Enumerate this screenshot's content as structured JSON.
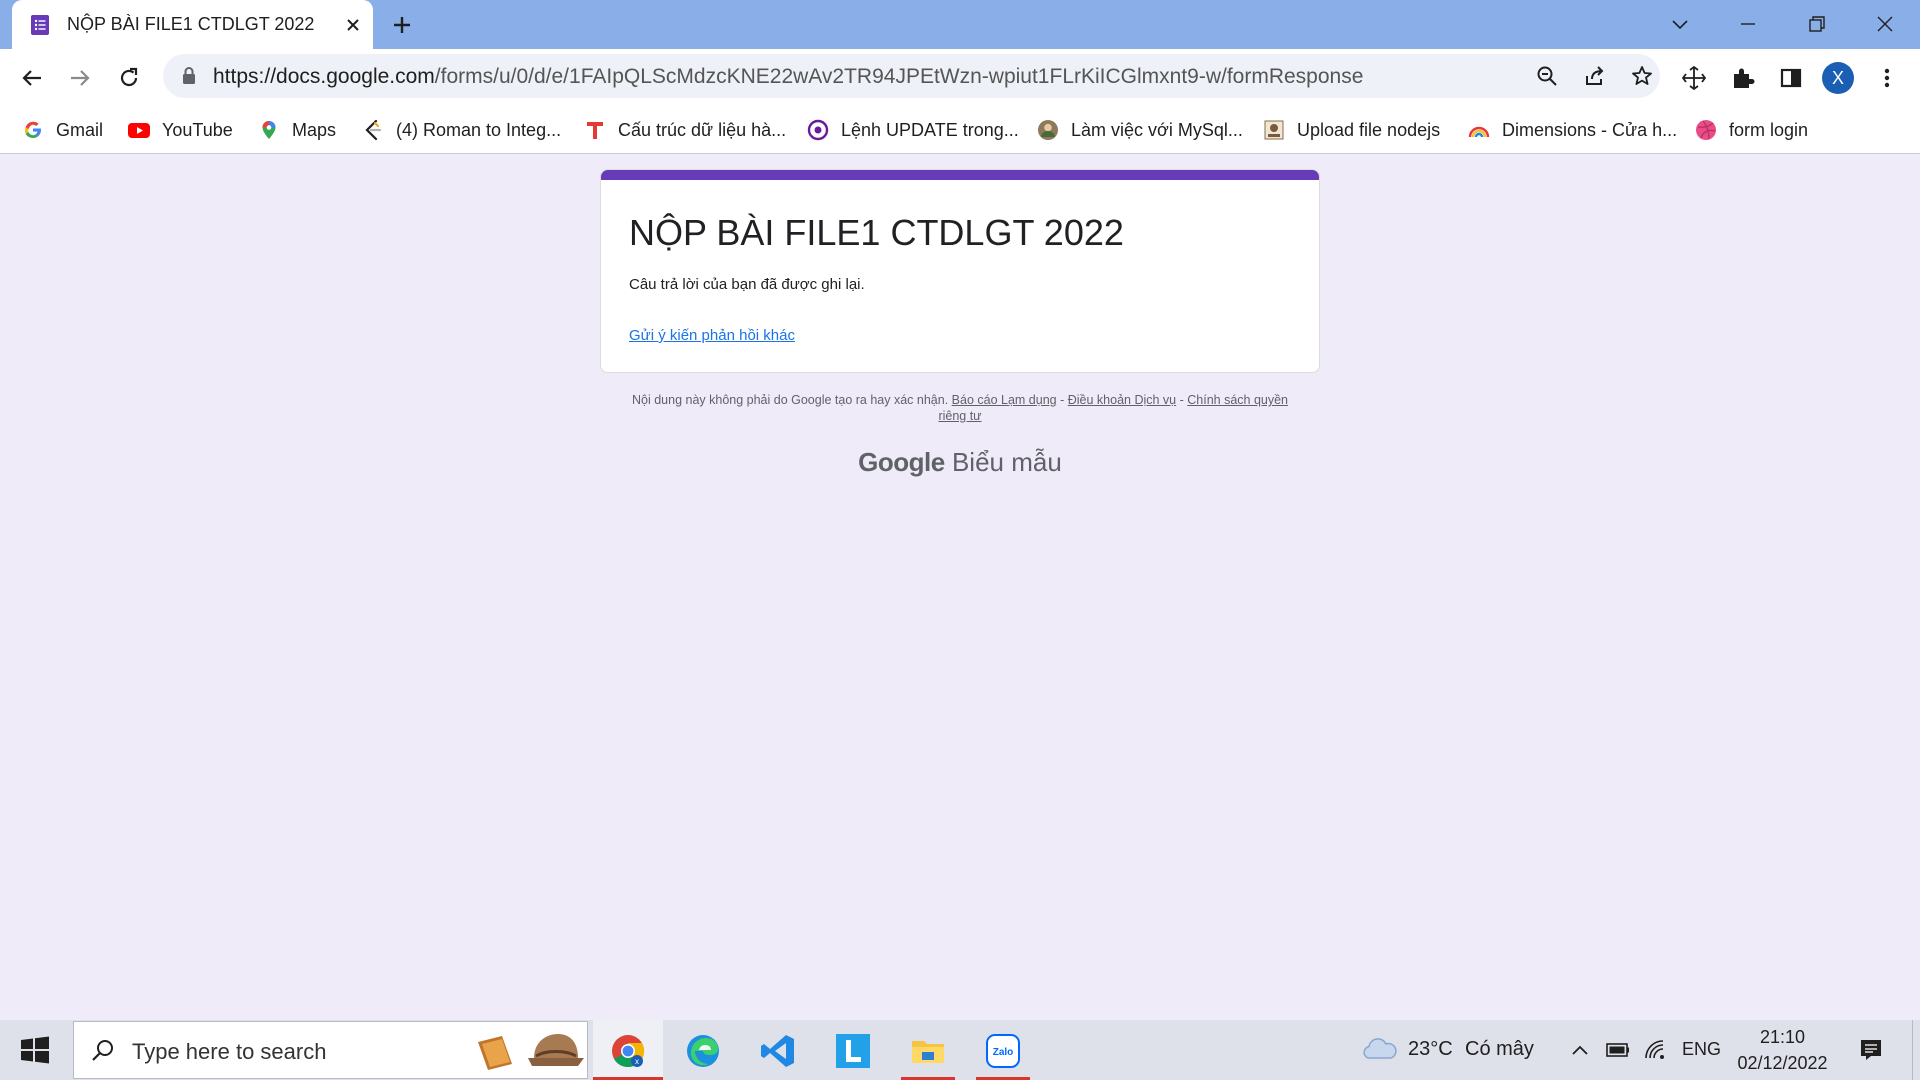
{
  "browser": {
    "tab_title": "NỘP BÀI FILE1 CTDLGT 2022",
    "url_host": "https://docs.google.com",
    "url_path": "/forms/u/0/d/e/1FAIpQLScMdzcKNE22wAv2TR94JPEtWzn-wpiut1FLrKiICGlmxnt9-w/formResponse",
    "profile_initial": "X"
  },
  "bookmarks": [
    {
      "label": "Gmail",
      "icon": "google-icon"
    },
    {
      "label": "YouTube",
      "icon": "youtube-icon"
    },
    {
      "label": "Maps",
      "icon": "maps-icon"
    },
    {
      "label": "(4) Roman to Integ...",
      "icon": "leetcode-icon"
    },
    {
      "label": "Cấu trúc dữ liệu hà...",
      "icon": "t-logo-icon"
    },
    {
      "label": "Lệnh UPDATE trong...",
      "icon": "circle-logo-icon"
    },
    {
      "label": "Làm việc với MySql...",
      "icon": "avatar-icon"
    },
    {
      "label": "Upload file nodejs",
      "icon": "site-icon"
    },
    {
      "label": "Dimensions - Cửa h...",
      "icon": "rainbow-icon"
    },
    {
      "label": "form login",
      "icon": "dribbble-icon"
    }
  ],
  "form": {
    "title": "NỘP BÀI FILE1 CTDLGT 2022",
    "confirmation": "Câu trả lời của bạn đã được ghi lại.",
    "submit_another": "Gửi ý kiến phản hồi khác"
  },
  "footer": {
    "disclaimer": "Nội dung này không phải do Google tạo ra hay xác nhận.",
    "report": "Báo cáo Lạm dụng",
    "terms": "Điều khoản Dịch vụ",
    "privacy": "Chính sách quyền riêng tư",
    "sep": " - ",
    "brand_google": "Google",
    "brand_forms": "Biểu mẫu"
  },
  "taskbar": {
    "search_placeholder": "Type here to search",
    "weather": "23°C",
    "weather_desc": "Có mây",
    "lang": "ENG",
    "time": "21:10",
    "date": "02/12/2022"
  },
  "colors": {
    "form_accent": "#673ab7",
    "page_bg": "#f0ebf8",
    "tabstrip": "#8aaee8"
  }
}
